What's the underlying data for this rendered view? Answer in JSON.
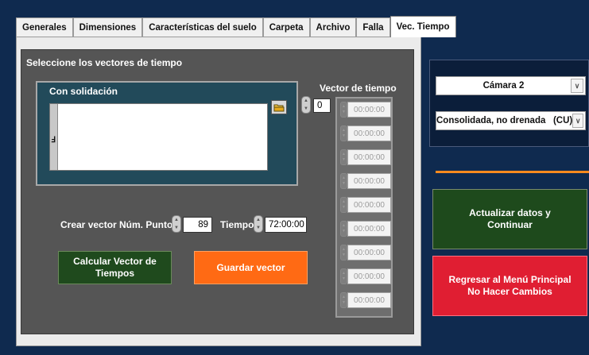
{
  "tabs": [
    "Generales",
    "Dimensiones",
    "Características del suelo",
    "Carpeta",
    "Archivo",
    "Falla",
    "Vec. Tiempo"
  ],
  "panel": {
    "section_title": "Seleccione los vectores de tiempo",
    "consolidation": {
      "title": "Con solidación",
      "path_value": ""
    },
    "time_vector": {
      "title": "Vector de tiempo",
      "index": "0",
      "cells": [
        "00:00:00",
        "00:00:00",
        "00:00:00",
        "00:00:00",
        "00:00:00",
        "00:00:00",
        "00:00:00",
        "00:00:00",
        "00:00:00"
      ]
    },
    "create_vector": {
      "label": "Crear vector",
      "points_label": "Núm. Puntos",
      "points_value": "89",
      "time_label": "Tiempo",
      "time_value": "72:00:00"
    },
    "calc_button": "Calcular Vector de Tiempos",
    "save_button": "Guardar vector"
  },
  "right": {
    "camera_select": "Cámara 2",
    "test_select": "Consolidada, no drenada   (CU)",
    "update_button": "Actualizar datos y\nContinuar",
    "return_button": "Regresar al Menú  Principal\nNo Hacer Cambios"
  },
  "colors": {
    "background": "#0f2a4f",
    "update_button": "#1e4a1c",
    "return_button": "#e01e32",
    "save_button": "#ff6a14",
    "separator": "#ff8a1e"
  }
}
